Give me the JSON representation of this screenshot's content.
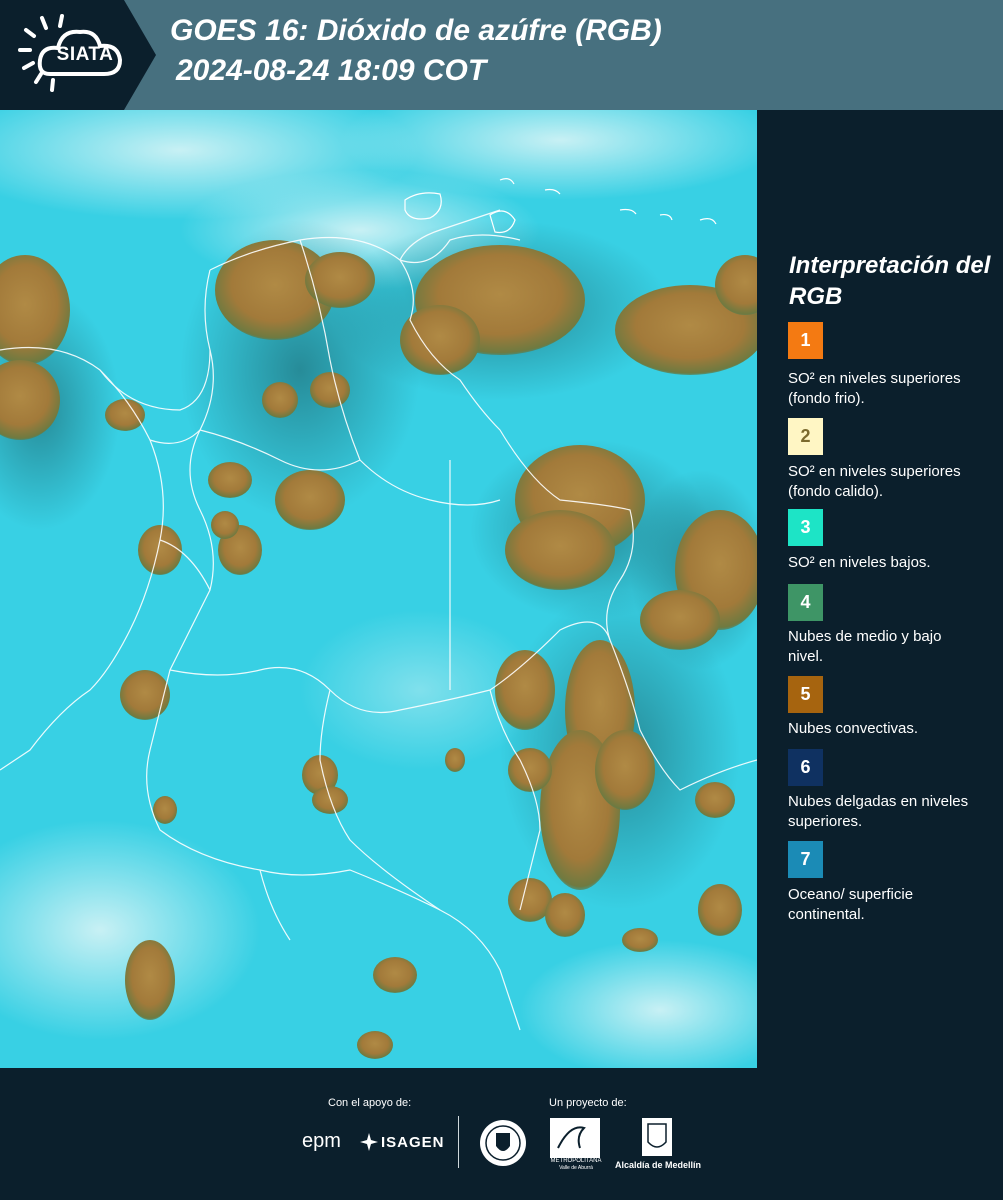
{
  "header": {
    "logo_text": "SIATA",
    "title_line1": "GOES 16: Dióxido de azúfre (RGB)",
    "title_line2": "2024-08-24 18:09 COT"
  },
  "map": {
    "icon": "satellite-rgb-map"
  },
  "legend": {
    "title": "Interpretación del RGB",
    "items": [
      {
        "number": "1",
        "color": "#f47a12",
        "text": "SO² en niveles superiores (fondo frio)."
      },
      {
        "number": "2",
        "color": "#fff6c4",
        "text": "SO² en niveles superiores (fondo calido)."
      },
      {
        "number": "3",
        "color": "#1de4c6",
        "text": "SO² en niveles bajos."
      },
      {
        "number": "4",
        "color": "#3e9566",
        "text": "Nubes de medio y bajo nivel."
      },
      {
        "number": "5",
        "color": "#a6640f",
        "text": "Nubes convectivas."
      },
      {
        "number": "6",
        "color": "#0f3161",
        "text": "Nubes delgadas en niveles superiores."
      },
      {
        "number": "7",
        "color": "#1b8bb6",
        "text": "Oceano/ superficie continental."
      }
    ]
  },
  "footer": {
    "support_label": "Con el apoyo de:",
    "project_label": "Un proyecto de:",
    "sponsors": [
      "epm",
      "ISAGEN"
    ],
    "partners": [
      "METROPOLITANA",
      "Valle de Aburrá",
      "Alcaldía de Medellín"
    ]
  }
}
